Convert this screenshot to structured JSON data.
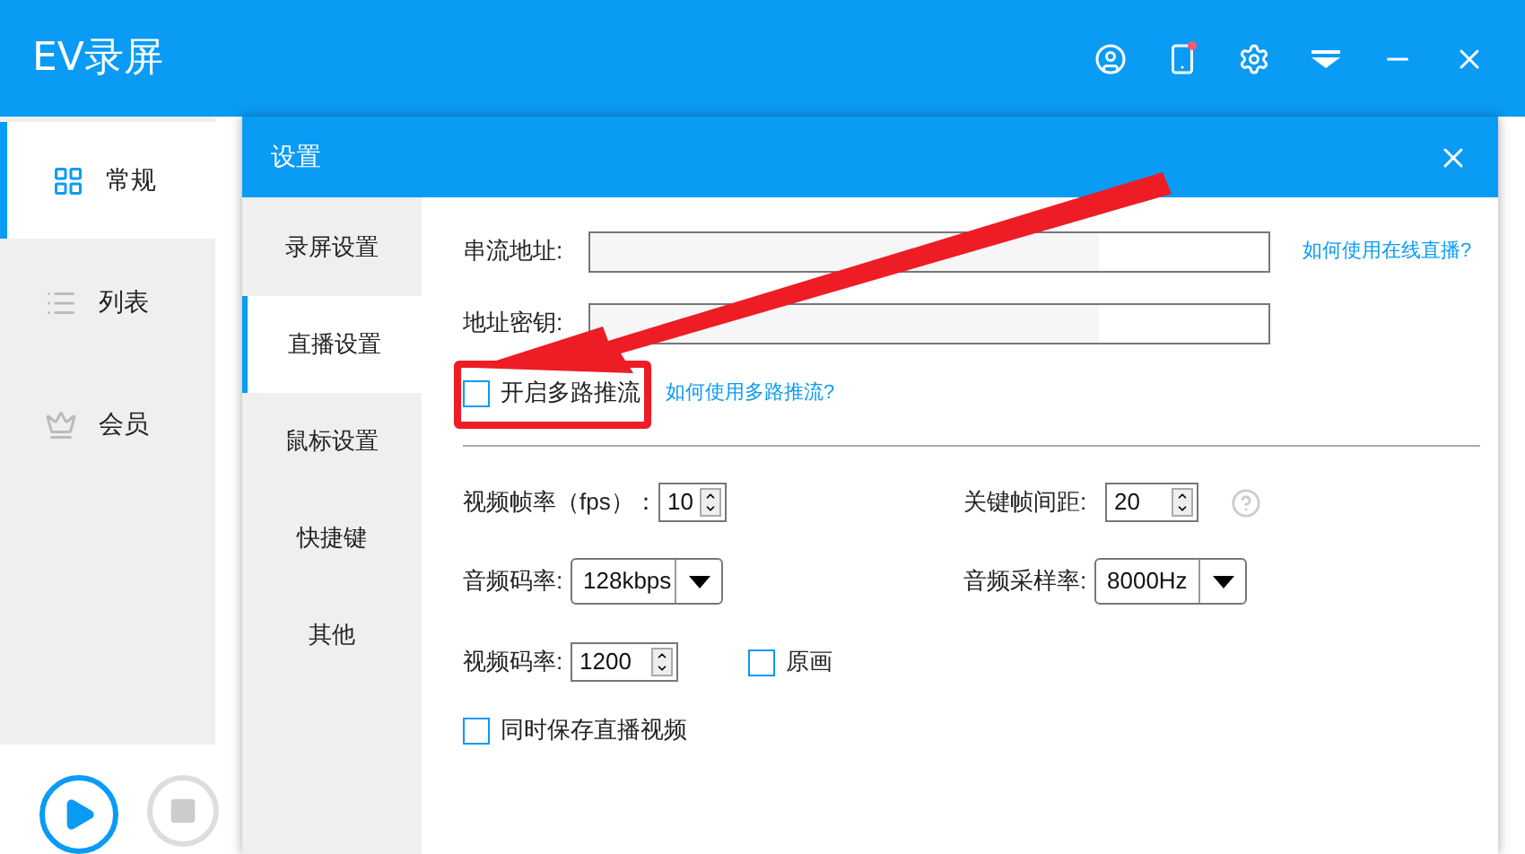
{
  "app": {
    "title": "EV录屏"
  },
  "sidebar": {
    "items": [
      {
        "label": "常规",
        "selected": true
      },
      {
        "label": "列表",
        "selected": false
      },
      {
        "label": "会员",
        "selected": false
      }
    ]
  },
  "dialog": {
    "title": "设置",
    "nav": [
      {
        "label": "录屏设置",
        "selected": false
      },
      {
        "label": "直播设置",
        "selected": true
      },
      {
        "label": "鼠标设置",
        "selected": false
      },
      {
        "label": "快捷键",
        "selected": false
      },
      {
        "label": "其他",
        "selected": false
      }
    ],
    "stream_url": {
      "label": "串流地址:",
      "link": "如何使用在线直播?"
    },
    "stream_key": {
      "label": "地址密钥:"
    },
    "multi_push": {
      "label": "开启多路推流",
      "checked": false,
      "link": "如何使用多路推流?"
    },
    "fps": {
      "label": "视频帧率（fps）：",
      "value": "10"
    },
    "keyframe": {
      "label": "关键帧间距:",
      "value": "20"
    },
    "audio_bitrate": {
      "label": "音频码率:",
      "value": "128kbps"
    },
    "sample_rate": {
      "label": "音频采样率:",
      "value": "8000Hz"
    },
    "video_bitrate": {
      "label": "视频码率:",
      "value": "1200"
    },
    "original": {
      "label": "原画",
      "checked": false
    },
    "save_video": {
      "label": "同时保存直播视频",
      "checked": false
    }
  }
}
